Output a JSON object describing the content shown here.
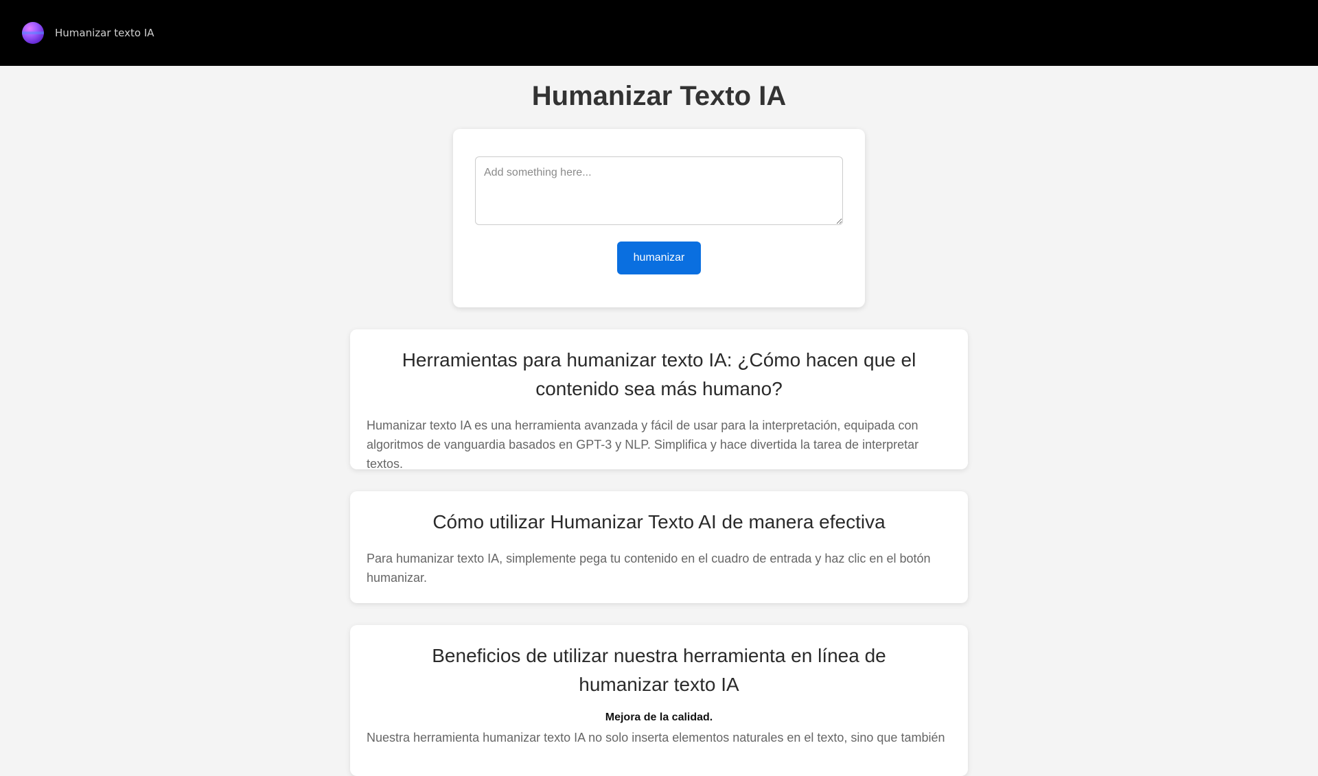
{
  "navbar": {
    "brand": "Humanizar texto IA",
    "logo_icon": "gradient-orb-logo"
  },
  "page_title": "Humanizar Texto IA",
  "form": {
    "placeholder": "Add something here...",
    "value": "",
    "button_label": "humanizar"
  },
  "sections": [
    {
      "title": "Herramientas para humanizar texto IA: ¿Cómo hacen que el contenido sea más humano?",
      "body": "Humanizar texto IA es una herramienta avanzada y fácil de usar para la interpretación, equipada con algoritmos de vanguardia basados en GPT-3 y NLP. Simplifica y hace divertida la tarea de interpretar textos."
    },
    {
      "title": "Cómo utilizar Humanizar Texto AI de manera efectiva",
      "body": "Para humanizar texto IA, simplemente pega tu contenido en el cuadro de entrada y haz clic en el botón humanizar."
    },
    {
      "title": "Beneficios de utilizar nuestra herramienta en línea de humanizar texto IA",
      "subtitle": "Mejora de la calidad.",
      "body": "Nuestra herramienta humanizar texto IA no solo inserta elementos naturales en el texto, sino que también"
    }
  ],
  "colors": {
    "navbar_bg": "#000000",
    "page_bg": "#f4f4f4",
    "button_bg": "#0a6fe0"
  }
}
